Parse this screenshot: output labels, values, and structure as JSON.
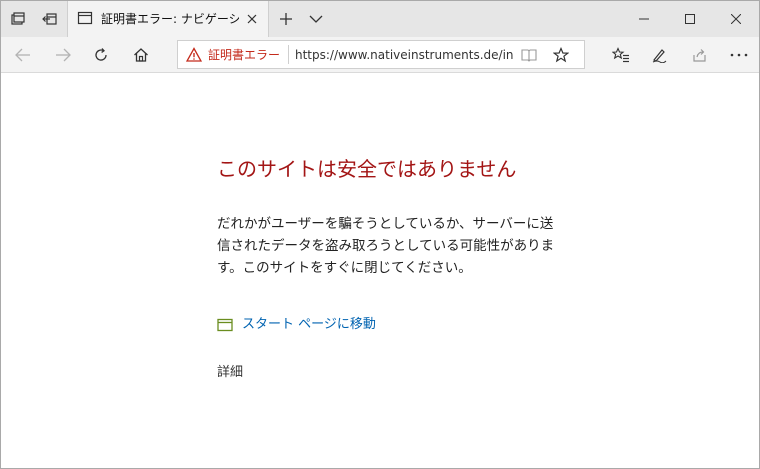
{
  "tab": {
    "title": "証明書エラー: ナビゲーション"
  },
  "address_bar": {
    "cert_error_label": "証明書エラー",
    "url": "https://www.nativeinstruments.de/index"
  },
  "page": {
    "title": "このサイトは安全ではありません",
    "description": "だれかがユーザーを騙そうとしているか、サーバーに送信されたデータを盗み取ろうとしている可能性があります。このサイトをすぐに閉じてください。",
    "start_page_link": "スタート ページに移動",
    "details_link": "詳細"
  },
  "colors": {
    "error_red": "#a31515",
    "link_blue": "#0063b1",
    "chrome_bg": "#e6e6e6"
  }
}
